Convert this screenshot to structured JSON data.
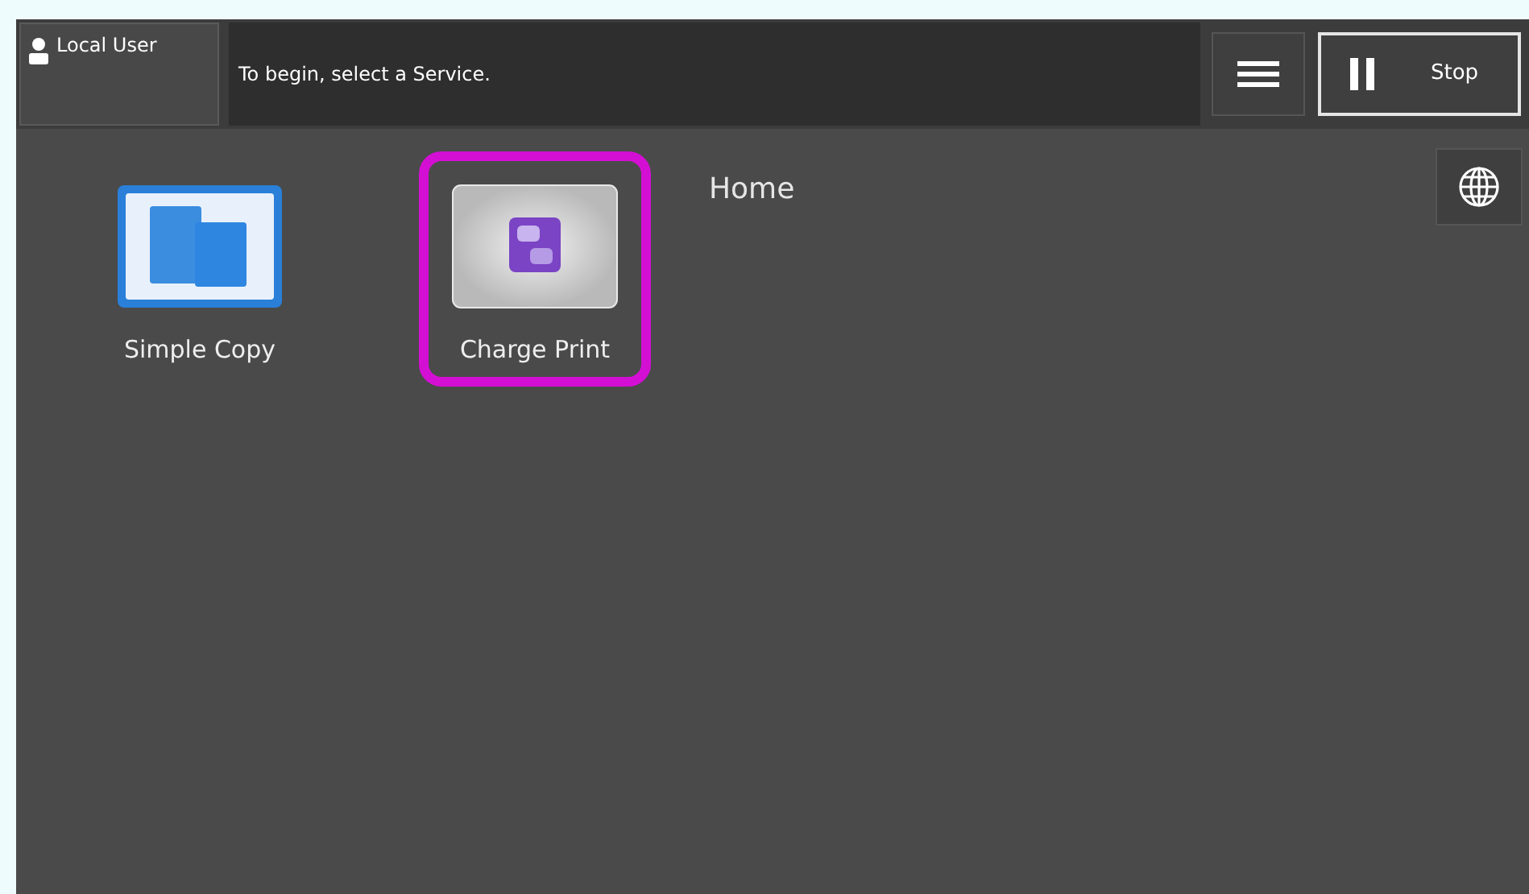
{
  "user_button": {
    "label": "Local User"
  },
  "message": "To begin, select a Service.",
  "stop_button": {
    "label": "Stop"
  },
  "title": "Home",
  "apps": [
    {
      "label": "Simple Copy",
      "kind": "copy",
      "selected": false
    },
    {
      "label": "Charge Print",
      "kind": "charge",
      "selected": true
    }
  ]
}
